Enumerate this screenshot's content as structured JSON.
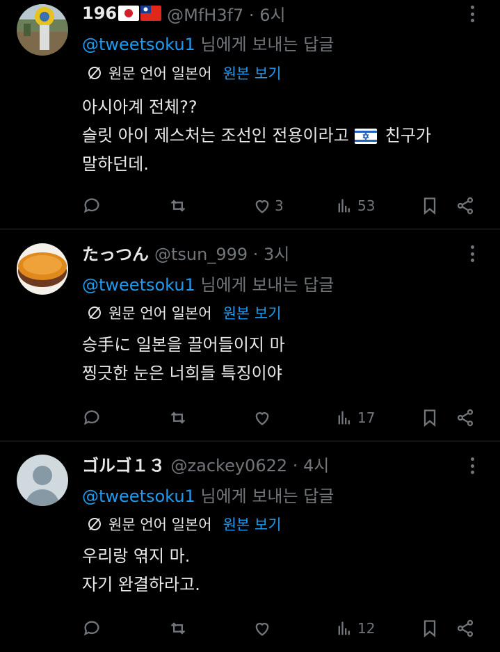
{
  "replying_suffix": "님에게 보내는 답글",
  "translate_label": "원문 언어 일본어",
  "show_original_label": "원본 보기",
  "accent_color": "#1d9bf0",
  "tweets": [
    {
      "name": "196",
      "handle": "@MfH3f7 · 6시",
      "mention": "@tweetsoku1",
      "lines": [
        "아시아계 전체??",
        "슬릿 아이 제스처는 조선인 전용이라고",
        "친구가",
        "말하던데."
      ],
      "likes": "3",
      "views": "53"
    },
    {
      "name": "たっつん",
      "handle": "@tsun_999 · 3시",
      "mention": "@tweetsoku1",
      "lines": [
        "승手に 일본을 끌어들이지 마",
        "찡긋한 눈은 너희들 특징이야"
      ],
      "likes": "",
      "views": "17"
    },
    {
      "name": "ゴルゴ１３",
      "handle": "@zackey0622 · 4시",
      "mention": "@tweetsoku1",
      "lines": [
        "우리랑 엮지 마.",
        "자기 완결하라고."
      ],
      "likes": "",
      "views": "12"
    }
  ]
}
